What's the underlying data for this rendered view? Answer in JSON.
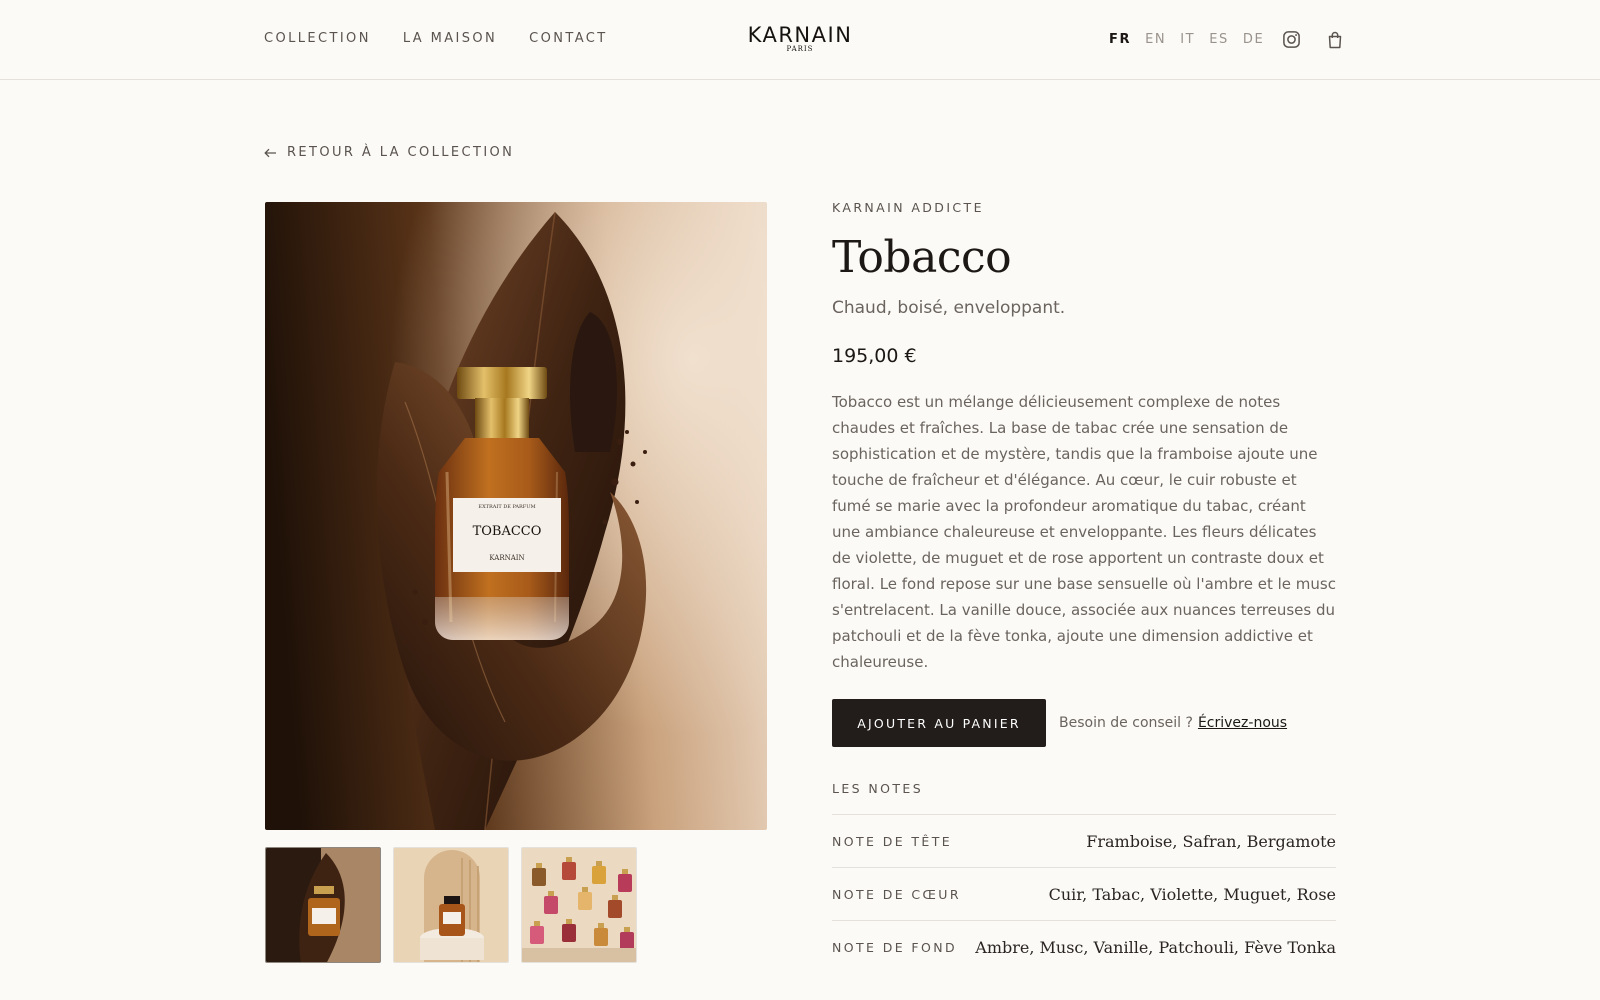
{
  "header": {
    "nav": [
      "COLLECTION",
      "LA MAISON",
      "CONTACT"
    ],
    "logo": {
      "name": "KARNAIN",
      "sub": "PARIS"
    },
    "languages": [
      "FR",
      "EN",
      "IT",
      "ES",
      "DE"
    ],
    "active_language": "FR",
    "icons": [
      "instagram-icon",
      "shopping-bag-icon"
    ]
  },
  "back_link": {
    "label": "RETOUR À LA COLLECTION",
    "icon": "arrow-left-icon"
  },
  "product": {
    "collection": "KARNAIN ADDICTE",
    "name": "Tobacco",
    "tagline": "Chaud, boisé, enveloppant.",
    "price": "195,00 €",
    "description": "Tobacco est un mélange délicieusement complexe de notes chaudes et fraîches. La base de tabac crée une sensation de sophistication et de mystère, tandis que la framboise ajoute une touche de fraîcheur et d'élégance. Au cœur, le cuir robuste et fumé se marie avec la profondeur aromatique du tabac, créant une ambiance chaleureuse et enveloppante. Les fleurs délicates de violette, de muguet et de rose apportent un contraste doux et floral. Le fond repose sur une base sensuelle où l'ambre et le musc s'entrelacent. La vanille douce, associée aux nuances terreuses du patchouli et de la fève tonka, ajoute une dimension addictive et chaleureuse.",
    "label_top": "EXTRAIT DE PARFUM",
    "label_name": "TOBACCO",
    "label_brand": "KARNAIN",
    "add_to_cart": "AJOUTER AU PANIER",
    "help_text": "Besoin de conseil ?",
    "help_link": "Écrivez-nous"
  },
  "notes": {
    "heading": "LES NOTES",
    "rows": [
      {
        "label": "NOTE DE TÊTE",
        "value": "Framboise, Safran, Bergamote"
      },
      {
        "label": "NOTE DE CŒUR",
        "value": "Cuir, Tabac, Violette, Muguet, Rose"
      },
      {
        "label": "NOTE DE FOND",
        "value": "Ambre, Musc, Vanille, Patchouli, Fève Tonka"
      }
    ]
  },
  "colors": {
    "background": "#fbfaf7",
    "button": "#221d1b",
    "text_dark": "#1c1815",
    "text_muted": "#6b645e"
  }
}
